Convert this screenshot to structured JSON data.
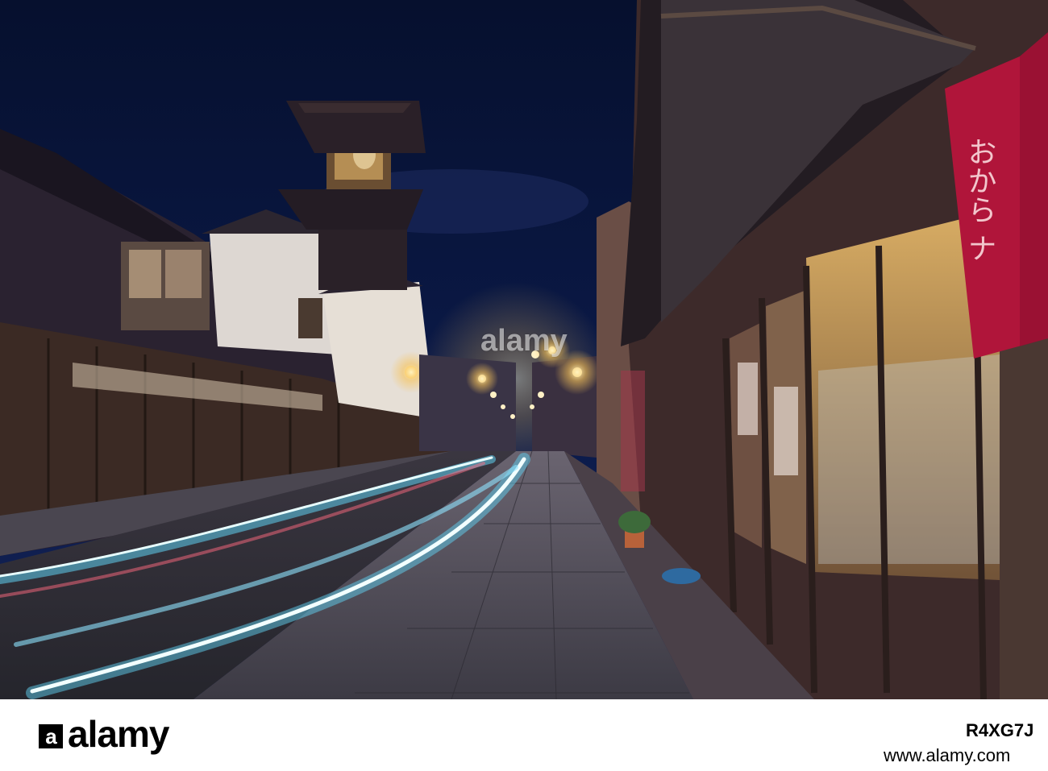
{
  "photo": {
    "noren_text": "おから ナ",
    "sky_color": "#0b1640",
    "street_glow": "#f6c35a",
    "light_trail_color": "#9fe6ff",
    "noren_color": "#b0153a"
  },
  "watermark": {
    "center_text": "alamy",
    "tile_text": "a"
  },
  "footer": {
    "logo_text": "alamy",
    "image_id": "R4XG7J",
    "url": "www.alamy.com"
  }
}
